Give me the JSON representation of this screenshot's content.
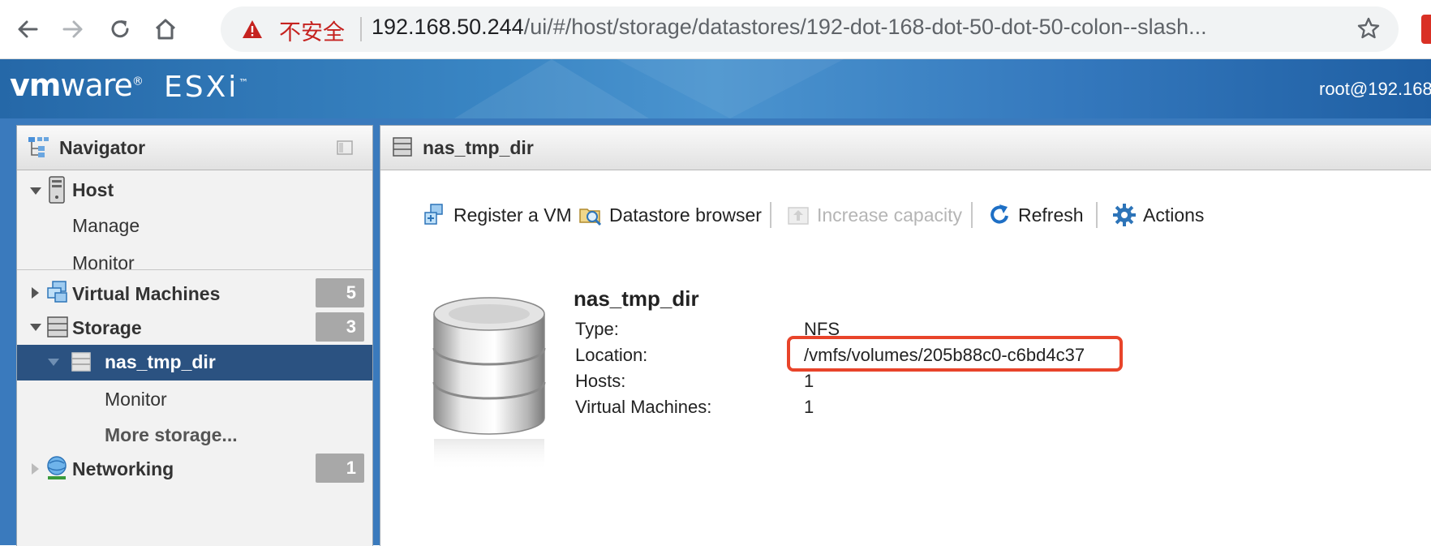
{
  "browser": {
    "security_label": "不安全",
    "url_host": "192.168.50.244",
    "url_path": "/ui/#/host/storage/datastores/192-dot-168-dot-50-dot-50-colon--slash..."
  },
  "app": {
    "logo_vm": "vm",
    "logo_ware": "ware",
    "logo_product": "ESXi",
    "user": "root@192.168"
  },
  "navigator": {
    "title": "Navigator",
    "items": [
      {
        "label": "Host",
        "badge": ""
      },
      {
        "label": "Manage"
      },
      {
        "label": "Monitor"
      },
      {
        "label": "Virtual Machines",
        "badge": "5"
      },
      {
        "label": "Storage",
        "badge": "3"
      },
      {
        "label": "nas_tmp_dir"
      },
      {
        "label": "Monitor"
      },
      {
        "label": "More storage..."
      },
      {
        "label": "Networking",
        "badge": "1"
      }
    ]
  },
  "main": {
    "title": "nas_tmp_dir",
    "toolbar": {
      "register_vm": "Register a VM",
      "datastore_browser": "Datastore browser",
      "increase_capacity": "Increase capacity",
      "refresh": "Refresh",
      "actions": "Actions"
    },
    "datastore": {
      "name": "nas_tmp_dir",
      "properties": [
        {
          "label": "Type:",
          "value": "NFS"
        },
        {
          "label": "Location:",
          "value": "/vmfs/volumes/205b88c0-c6bd4c37"
        },
        {
          "label": "Hosts:",
          "value": "1"
        },
        {
          "label": "Virtual Machines:",
          "value": "1"
        }
      ]
    }
  },
  "colors": {
    "header_blue": "#3a86c4",
    "selected_row": "#2b5281",
    "badge_gray": "#a8a8a8",
    "highlight_red": "#e8442a",
    "insecure_red": "#c5221f"
  },
  "icons": [
    "back-icon",
    "forward-icon",
    "reload-icon",
    "home-icon",
    "warning-icon",
    "star-icon",
    "tree-icon",
    "collapse-icon",
    "server-icon",
    "vm-icon",
    "storage-icon",
    "datastore-icon",
    "network-icon",
    "register-vm-icon",
    "datastore-browser-icon",
    "increase-capacity-icon",
    "refresh-icon",
    "gear-icon",
    "database-image"
  ]
}
